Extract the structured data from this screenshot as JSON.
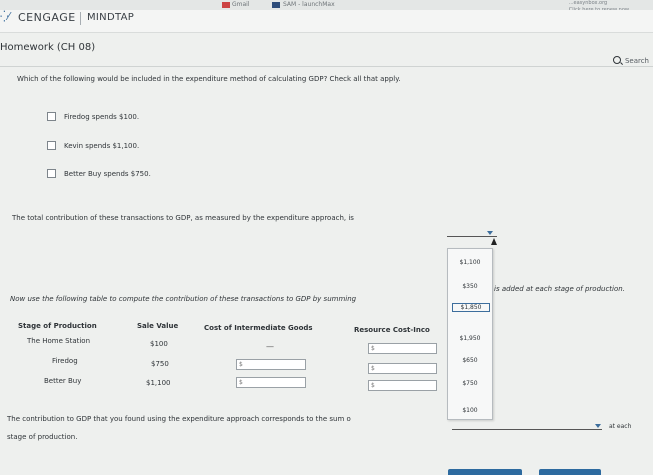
{
  "browser": {
    "bookmarks": [
      "Gmail",
      "SAM - launchMax"
    ],
    "notice_lines": [
      "...easynbox.org",
      "Click here to renew now"
    ]
  },
  "header": {
    "brand": "CENGAGE",
    "product": "MINDTAP"
  },
  "assignment": {
    "title": "Homework (CH 08)",
    "search_label": "Search"
  },
  "question1": {
    "prompt": "Which of the following would be included in the expenditure method of calculating GDP? Check all that apply.",
    "options": [
      "Firedog spends $100.",
      "Kevin spends $1,100.",
      "Better Buy spends $750."
    ]
  },
  "question2": {
    "prompt": "The total contribution of these transactions to GDP, as measured by the expenditure approach, is",
    "dropdown_options": [
      "$1,100",
      "$350",
      "$1,850",
      "$1,950",
      "$650",
      "$750",
      "$100"
    ],
    "highlighted_option": "$1,850"
  },
  "table_intro": {
    "text": "Now use the following table to compute the contribution of these transactions to GDP by summing",
    "suffix": "is added at each stage of production."
  },
  "table": {
    "headers": [
      "Stage of Production",
      "Sale Value",
      "Cost of Intermediate Goods",
      "Resource Cost-Inco"
    ],
    "rows": [
      {
        "stage": "The Home Station",
        "sale": "$100",
        "intermediate": "—",
        "resource": "$"
      },
      {
        "stage": "Firedog",
        "sale": "$750",
        "intermediate": "$",
        "resource": "$"
      },
      {
        "stage": "Better Buy",
        "sale": "$1,100",
        "intermediate": "$",
        "resource": "$"
      }
    ]
  },
  "conclusion": {
    "text": "The contribution to GDP that you found using the expenditure approach corresponds to the sum o",
    "suffix": "at each",
    "line2": "stage of production."
  },
  "colors": {
    "accent": "#3d6e9d",
    "background": "#eef0ee"
  }
}
